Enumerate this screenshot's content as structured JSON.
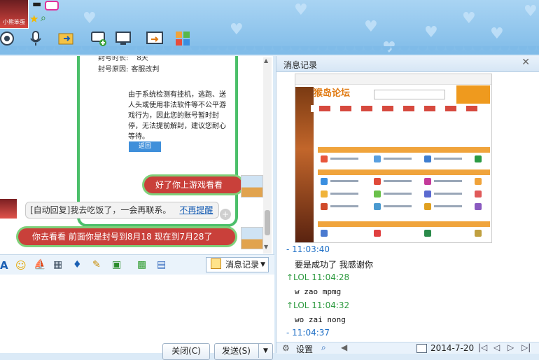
{
  "title_avatar_text": "小熊笨蛋",
  "chat": {
    "card": {
      "ban_duration_label": "封号时长:",
      "ban_duration_value": "8天",
      "ban_reason_label": "封号原因:",
      "ban_reason_value": "客服改判",
      "description": "由于系统检测有挂机，逃跑、送人头或使用非法软件等不公平游戏行为，因此您的账号暂时封停，无法提前解封，建议您耐心等待。",
      "back_button": "返回"
    },
    "bubble_self_1": "好了你上游戏看看",
    "auto_reply": "[自动回复]我去吃饭了，一会再联系。",
    "no_remind_link": "不再提醒",
    "bubble_self_2": "你去看看 前面你是封号到8月18 现在到7月28了"
  },
  "input_toolbar": {
    "history_button": "消息记录"
  },
  "buttons": {
    "close": "关闭(C)",
    "send": "发送(S)"
  },
  "history": {
    "title": "消息记录",
    "screenshot_site_logo": "猴岛论坛",
    "entries": [
      {
        "header": "- 11:03:40",
        "text": "要是成功了 我感谢你"
      },
      {
        "header": "↑LOL 11:04:28",
        "text": "w zao mpmg"
      },
      {
        "header": "↑LOL 11:04:32",
        "text": "wo zai nong"
      },
      {
        "header": "- 11:04:37",
        "text": ""
      }
    ],
    "footer": {
      "settings": "设置",
      "date": "2014-7-20"
    }
  }
}
